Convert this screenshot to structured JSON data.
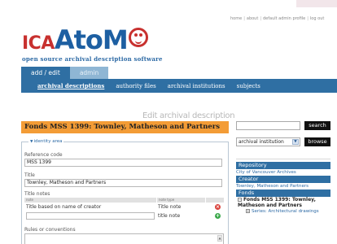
{
  "header": {
    "links": [
      "home",
      "about",
      "default admin profile",
      "log out"
    ],
    "logo": {
      "ica": "ICA",
      "atom": "AtoM",
      "tagline": "open source archival description software"
    }
  },
  "nav": {
    "primary": [
      {
        "label": "add / edit",
        "active": true
      },
      {
        "label": "admin",
        "active": false
      }
    ],
    "secondary": [
      {
        "label": "archival descriptions",
        "active": true
      },
      {
        "label": "authority files",
        "active": false
      },
      {
        "label": "archival institutions",
        "active": false
      },
      {
        "label": "subjects",
        "active": false
      }
    ]
  },
  "main": {
    "page_heading": "Edit archival description",
    "record_title": "Fonds MSS 1399: Townley, Matheson and Partners",
    "identity_area": {
      "legend": "identity area",
      "reference_code_label": "Reference code",
      "reference_code_value": "MSS 1399",
      "title_label": "Title",
      "title_value": "Townley, Matheson and Partners",
      "title_notes_label": "Title notes",
      "notes_columns": [
        "note",
        "note type"
      ],
      "notes_rows": [
        {
          "note": "Title based on name of creator",
          "type": "Title note"
        },
        {
          "note": "",
          "type": "title note"
        }
      ],
      "rules_label": "Rules or conventions"
    }
  },
  "sidebar": {
    "search_value": "",
    "search_button": "search",
    "browse_select": "archival institution",
    "browse_button": "browse",
    "context": [
      {
        "header": "Repository",
        "link": "City of Vancouver Archives"
      },
      {
        "header": "Creator",
        "link": "Townley, Matheson and Partners"
      }
    ],
    "fonds_header": "Fonds",
    "fonds_item": "Fonds MSS 1399: Townley, Matheson and Partners",
    "series_item": "Series: Architectural drawings"
  },
  "colors": {
    "brand_blue": "#2f6fa3",
    "title_orange": "#f39c36",
    "logo_red": "#c8312f"
  }
}
